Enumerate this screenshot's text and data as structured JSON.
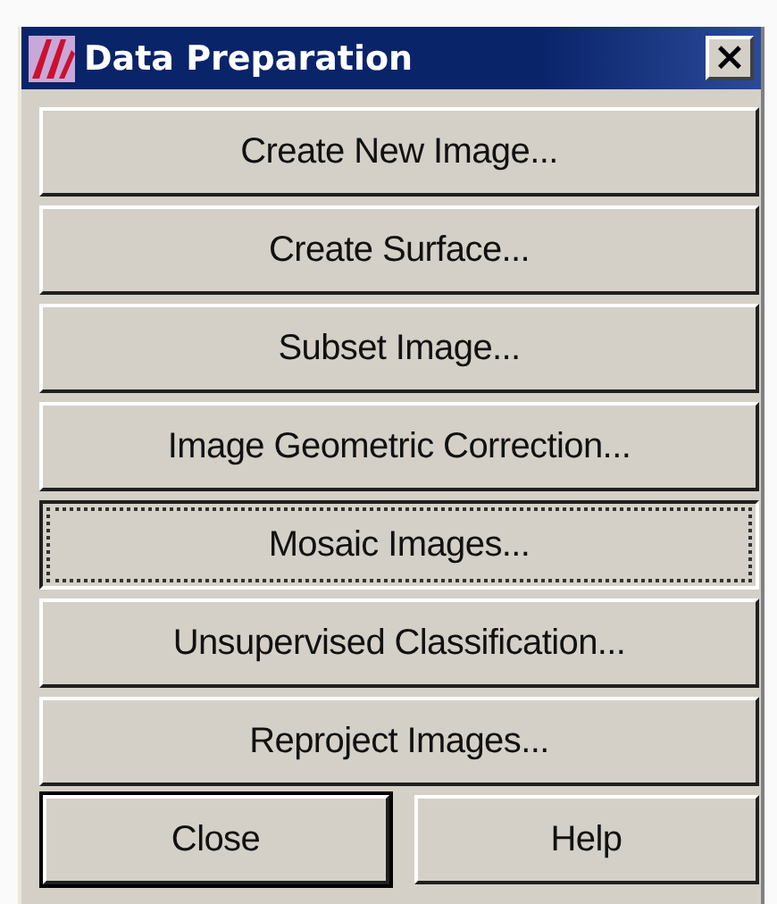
{
  "window": {
    "title": "Data Preparation",
    "close_label": "×"
  },
  "actions": [
    {
      "label": "Create New Image...",
      "focused": false
    },
    {
      "label": "Create Surface...",
      "focused": false
    },
    {
      "label": "Subset Image...",
      "focused": false
    },
    {
      "label": "Image Geometric Correction...",
      "focused": false
    },
    {
      "label": "Mosaic Images...",
      "focused": true
    },
    {
      "label": "Unsupervised Classification...",
      "focused": false
    },
    {
      "label": "Reproject Images...",
      "focused": false
    }
  ],
  "buttons": [
    {
      "label": "Close",
      "default": true
    },
    {
      "label": "Help",
      "default": false
    }
  ]
}
